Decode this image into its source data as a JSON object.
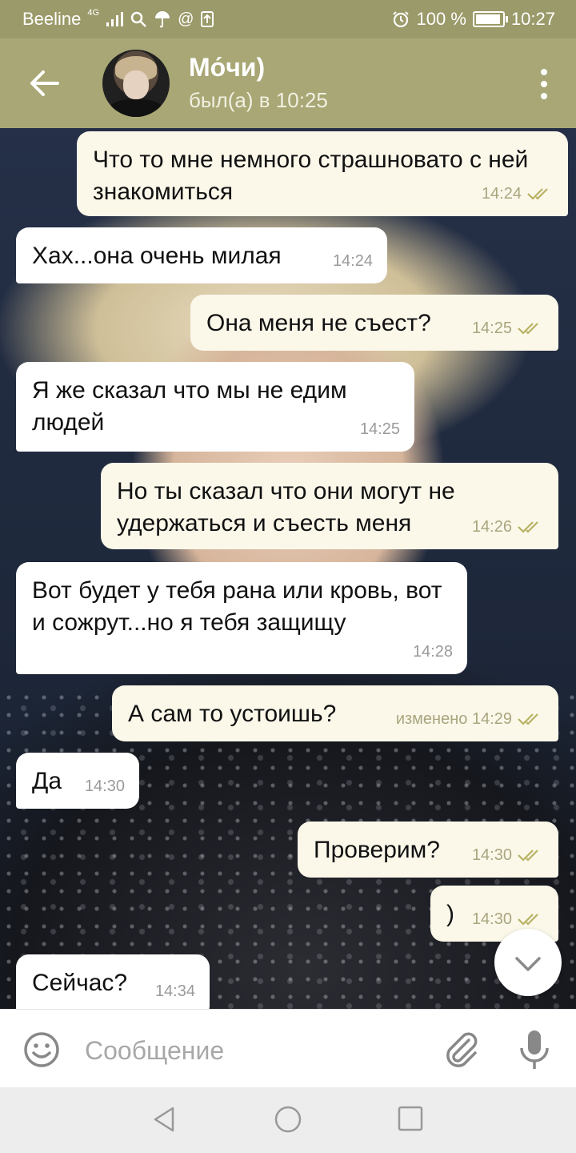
{
  "status_bar": {
    "carrier": "Beeline",
    "network": "4G",
    "battery": "100 %",
    "battery_level": 1.0,
    "time": "10:27"
  },
  "header": {
    "name": "Мо́чи)",
    "last_seen": "был(а) в 10:25"
  },
  "messages": [
    {
      "dir": "out",
      "text": "Что то мне немного страшновато с ней знакомиться",
      "time": "14:24",
      "status": "read"
    },
    {
      "dir": "in",
      "text": "Хах...она очень милая",
      "time": "14:24"
    },
    {
      "dir": "out",
      "text": "Она меня не съест?",
      "time": "14:25",
      "status": "read"
    },
    {
      "dir": "in",
      "text": "Я же сказал что мы не едим людей",
      "time": "14:25"
    },
    {
      "dir": "out",
      "text": "Но ты сказал что они могут не удержаться и съесть меня",
      "time": "14:26",
      "status": "read"
    },
    {
      "dir": "in",
      "text": "Вот будет у тебя рана или кровь, вот и сожрут...но я тебя защищу",
      "time": "14:28"
    },
    {
      "dir": "out",
      "text": "А сам то устоишь?",
      "time": "изменено 14:29",
      "status": "read"
    },
    {
      "dir": "in",
      "text": "Да",
      "time": "14:30"
    },
    {
      "dir": "out",
      "text": "Проверим?",
      "time": "14:30",
      "status": "read"
    },
    {
      "dir": "out",
      "text": ")",
      "time": "14:30",
      "status": "read"
    },
    {
      "dir": "in",
      "text": "Сейчас?",
      "time": "14:34"
    }
  ],
  "input": {
    "placeholder": "Сообщение"
  },
  "colors": {
    "header": "#a8a775",
    "status_bar": "#9b9a6a",
    "tick": "#b8b163"
  }
}
